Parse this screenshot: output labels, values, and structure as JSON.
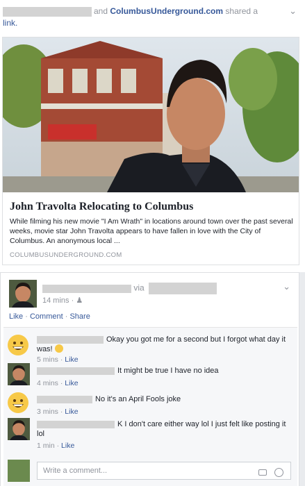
{
  "post1": {
    "header_shared": "and",
    "header_page": "ColumbusUnderground.com",
    "header_suffix": "shared a",
    "header_link": "link.",
    "link": {
      "title": "John Travolta Relocating to Columbus",
      "description": "While filming his new movie \"I Am Wrath\" in locations around town over the past several weeks, movie star John Travolta appears to have fallen in love with the City of Columbus. An anonymous local ...",
      "domain": "COLUMBUSUNDERGROUND.COM"
    }
  },
  "post2": {
    "via": "via",
    "time": "14 mins",
    "actions": {
      "like": "Like",
      "comment": "Comment",
      "share": "Share",
      "sep": "·"
    },
    "comments": [
      {
        "text": "Okay you got me for a second but I forgot what day it was!",
        "time": "5 mins",
        "like": "Like"
      },
      {
        "text": "It might be true I have no idea",
        "time": "4 mins",
        "like": "Like"
      },
      {
        "text": "No it's an April Fools joke",
        "time": "3 mins",
        "like": "Like"
      },
      {
        "text": "K I don't care either way lol I just felt like posting it lol",
        "time": "1 min",
        "like": "Like"
      }
    ],
    "write_placeholder": "Write a comment..."
  },
  "colors": {
    "link": "#365899",
    "muted": "#90949c",
    "bg": "#e9ebee"
  },
  "icons": [
    "chevron-down-icon",
    "friends-icon",
    "camera-icon",
    "emoji-icon",
    "grinning-emoji-icon"
  ]
}
